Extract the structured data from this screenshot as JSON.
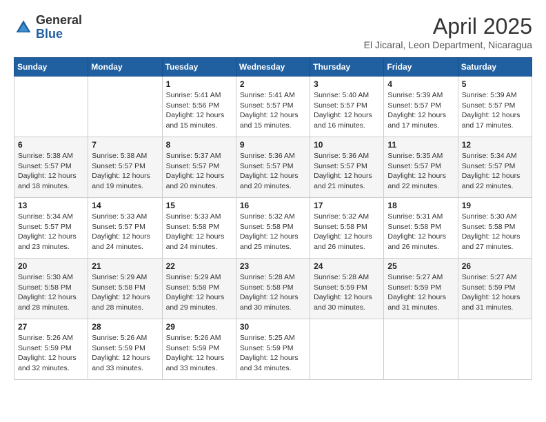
{
  "header": {
    "logo_general": "General",
    "logo_blue": "Blue",
    "month_title": "April 2025",
    "subtitle": "El Jicaral, Leon Department, Nicaragua"
  },
  "days_of_week": [
    "Sunday",
    "Monday",
    "Tuesday",
    "Wednesday",
    "Thursday",
    "Friday",
    "Saturday"
  ],
  "weeks": [
    [
      {
        "day": "",
        "info": ""
      },
      {
        "day": "",
        "info": ""
      },
      {
        "day": "1",
        "info": "Sunrise: 5:41 AM\nSunset: 5:56 PM\nDaylight: 12 hours and 15 minutes."
      },
      {
        "day": "2",
        "info": "Sunrise: 5:41 AM\nSunset: 5:57 PM\nDaylight: 12 hours and 15 minutes."
      },
      {
        "day": "3",
        "info": "Sunrise: 5:40 AM\nSunset: 5:57 PM\nDaylight: 12 hours and 16 minutes."
      },
      {
        "day": "4",
        "info": "Sunrise: 5:39 AM\nSunset: 5:57 PM\nDaylight: 12 hours and 17 minutes."
      },
      {
        "day": "5",
        "info": "Sunrise: 5:39 AM\nSunset: 5:57 PM\nDaylight: 12 hours and 17 minutes."
      }
    ],
    [
      {
        "day": "6",
        "info": "Sunrise: 5:38 AM\nSunset: 5:57 PM\nDaylight: 12 hours and 18 minutes."
      },
      {
        "day": "7",
        "info": "Sunrise: 5:38 AM\nSunset: 5:57 PM\nDaylight: 12 hours and 19 minutes."
      },
      {
        "day": "8",
        "info": "Sunrise: 5:37 AM\nSunset: 5:57 PM\nDaylight: 12 hours and 20 minutes."
      },
      {
        "day": "9",
        "info": "Sunrise: 5:36 AM\nSunset: 5:57 PM\nDaylight: 12 hours and 20 minutes."
      },
      {
        "day": "10",
        "info": "Sunrise: 5:36 AM\nSunset: 5:57 PM\nDaylight: 12 hours and 21 minutes."
      },
      {
        "day": "11",
        "info": "Sunrise: 5:35 AM\nSunset: 5:57 PM\nDaylight: 12 hours and 22 minutes."
      },
      {
        "day": "12",
        "info": "Sunrise: 5:34 AM\nSunset: 5:57 PM\nDaylight: 12 hours and 22 minutes."
      }
    ],
    [
      {
        "day": "13",
        "info": "Sunrise: 5:34 AM\nSunset: 5:57 PM\nDaylight: 12 hours and 23 minutes."
      },
      {
        "day": "14",
        "info": "Sunrise: 5:33 AM\nSunset: 5:57 PM\nDaylight: 12 hours and 24 minutes."
      },
      {
        "day": "15",
        "info": "Sunrise: 5:33 AM\nSunset: 5:58 PM\nDaylight: 12 hours and 24 minutes."
      },
      {
        "day": "16",
        "info": "Sunrise: 5:32 AM\nSunset: 5:58 PM\nDaylight: 12 hours and 25 minutes."
      },
      {
        "day": "17",
        "info": "Sunrise: 5:32 AM\nSunset: 5:58 PM\nDaylight: 12 hours and 26 minutes."
      },
      {
        "day": "18",
        "info": "Sunrise: 5:31 AM\nSunset: 5:58 PM\nDaylight: 12 hours and 26 minutes."
      },
      {
        "day": "19",
        "info": "Sunrise: 5:30 AM\nSunset: 5:58 PM\nDaylight: 12 hours and 27 minutes."
      }
    ],
    [
      {
        "day": "20",
        "info": "Sunrise: 5:30 AM\nSunset: 5:58 PM\nDaylight: 12 hours and 28 minutes."
      },
      {
        "day": "21",
        "info": "Sunrise: 5:29 AM\nSunset: 5:58 PM\nDaylight: 12 hours and 28 minutes."
      },
      {
        "day": "22",
        "info": "Sunrise: 5:29 AM\nSunset: 5:58 PM\nDaylight: 12 hours and 29 minutes."
      },
      {
        "day": "23",
        "info": "Sunrise: 5:28 AM\nSunset: 5:58 PM\nDaylight: 12 hours and 30 minutes."
      },
      {
        "day": "24",
        "info": "Sunrise: 5:28 AM\nSunset: 5:59 PM\nDaylight: 12 hours and 30 minutes."
      },
      {
        "day": "25",
        "info": "Sunrise: 5:27 AM\nSunset: 5:59 PM\nDaylight: 12 hours and 31 minutes."
      },
      {
        "day": "26",
        "info": "Sunrise: 5:27 AM\nSunset: 5:59 PM\nDaylight: 12 hours and 31 minutes."
      }
    ],
    [
      {
        "day": "27",
        "info": "Sunrise: 5:26 AM\nSunset: 5:59 PM\nDaylight: 12 hours and 32 minutes."
      },
      {
        "day": "28",
        "info": "Sunrise: 5:26 AM\nSunset: 5:59 PM\nDaylight: 12 hours and 33 minutes."
      },
      {
        "day": "29",
        "info": "Sunrise: 5:26 AM\nSunset: 5:59 PM\nDaylight: 12 hours and 33 minutes."
      },
      {
        "day": "30",
        "info": "Sunrise: 5:25 AM\nSunset: 5:59 PM\nDaylight: 12 hours and 34 minutes."
      },
      {
        "day": "",
        "info": ""
      },
      {
        "day": "",
        "info": ""
      },
      {
        "day": "",
        "info": ""
      }
    ]
  ]
}
